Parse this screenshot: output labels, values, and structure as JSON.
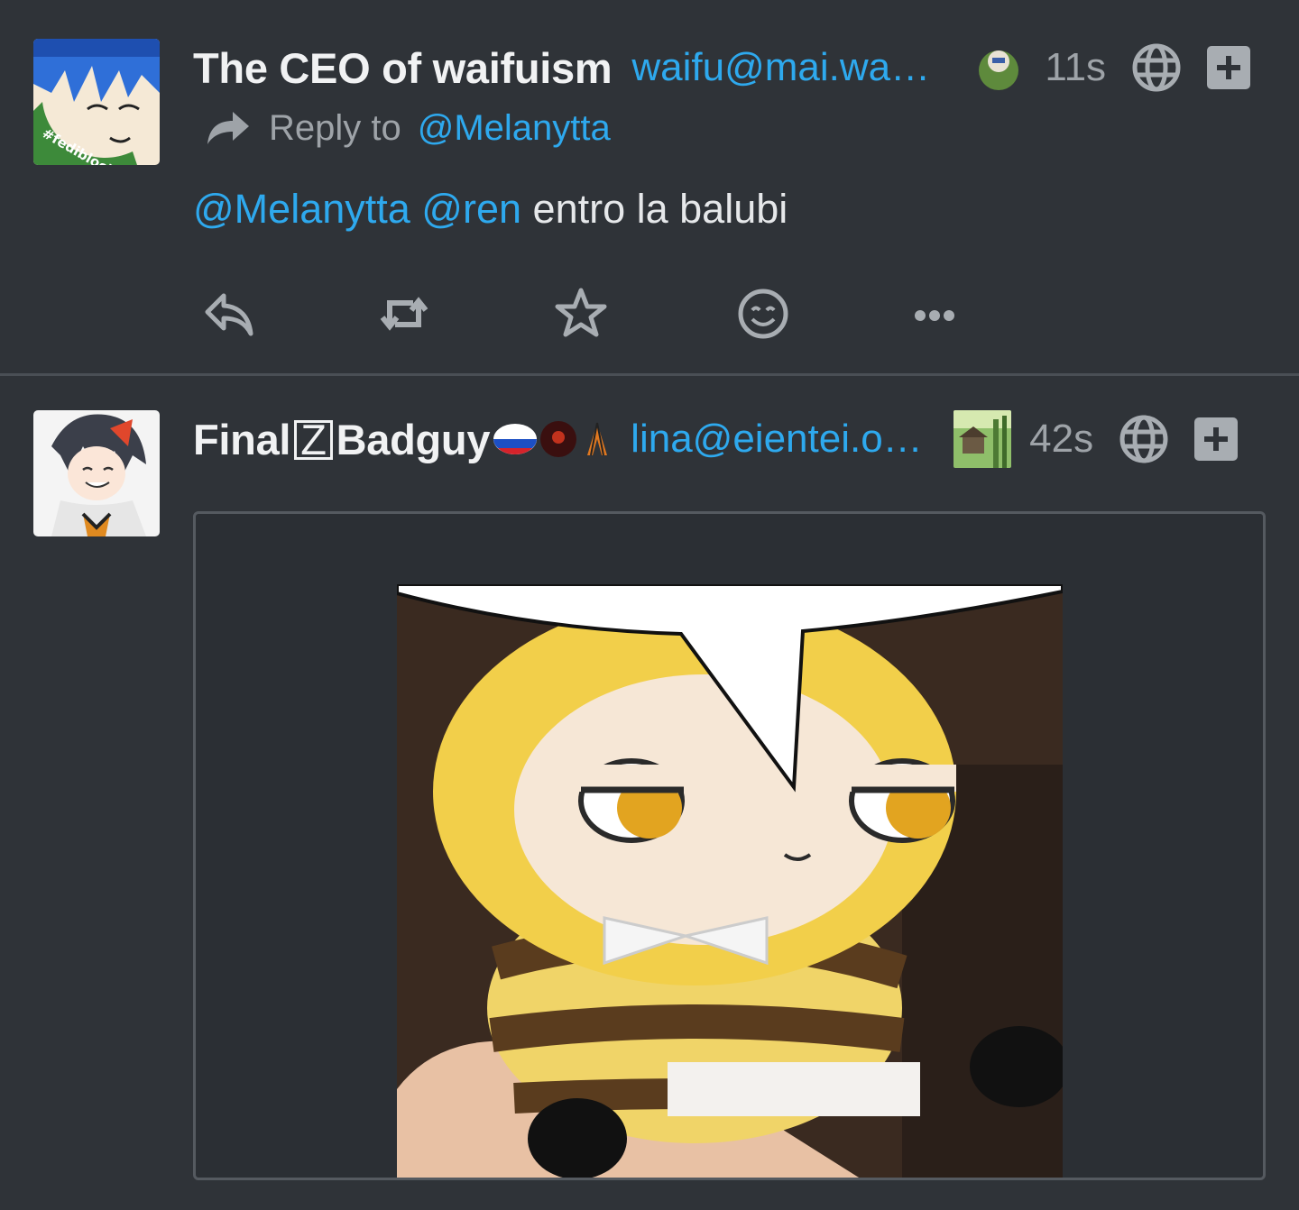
{
  "posts": [
    {
      "display_name": "The CEO of waifuism",
      "handle": "waifu@mai.wa…",
      "timestamp": "11s",
      "reply_prefix": "Reply to",
      "reply_target": "@Melanytta",
      "avatar_badge": "#fediblocked",
      "content": {
        "mention1": "@Melanytta",
        "mention2": "@ren",
        "text": "entro la balubi"
      },
      "actions": [
        "reply",
        "repeat",
        "favorite",
        "react",
        "more"
      ]
    },
    {
      "display_name_part1": "Final",
      "display_name_badge": "Z",
      "display_name_part2": "Badguy",
      "handle": "lina@eientei.o…",
      "timestamp": "42s"
    }
  ],
  "colors": {
    "background": "#2f3338",
    "link": "#2ea9ee",
    "muted": "#9ea3a8",
    "text": "#e6e8ea"
  }
}
